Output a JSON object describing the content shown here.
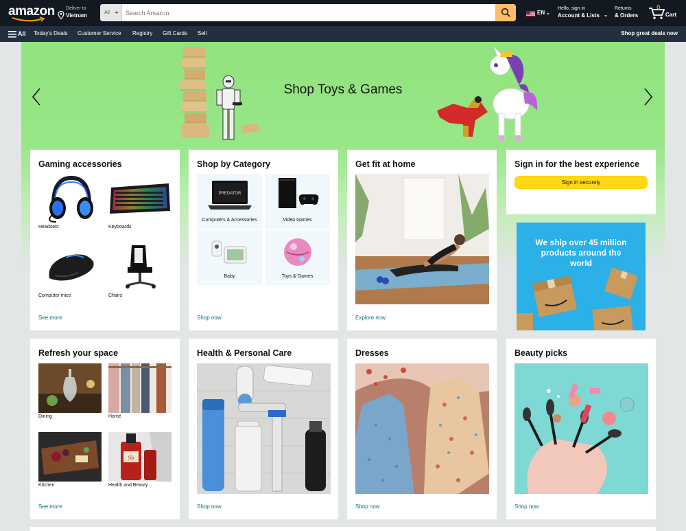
{
  "header": {
    "logo_text": "amazon",
    "deliver_label": "Deliver to",
    "deliver_location": "Vietnam",
    "search_category": "All",
    "search_placeholder": "Search Amazon",
    "language": "EN",
    "account_greeting": "Hello, sign in",
    "account_label": "Account & Lists",
    "returns_label": "Returns",
    "orders_label": "& Orders",
    "cart_count": "0",
    "cart_label": "Cart"
  },
  "subnav": {
    "all_label": "All",
    "links": [
      "Today's Deals",
      "Customer Service",
      "Registry",
      "Gift Cards",
      "Sell"
    ],
    "promo": "Shop great deals now"
  },
  "hero": {
    "title": "Shop Toys & Games"
  },
  "cards": {
    "gaming": {
      "title": "Gaming accessories",
      "items": [
        "Headsets",
        "Keyboards",
        "Computer mice",
        "Chairs"
      ],
      "link": "See more"
    },
    "category": {
      "title": "Shop by Category",
      "items": [
        "Computers & Accessories",
        "Video Games",
        "Baby",
        "Toys & Games"
      ],
      "link": "Shop now"
    },
    "fit": {
      "title": "Get fit at home",
      "link": "Explore now"
    },
    "signin": {
      "title": "Sign in for the best experience",
      "button": "Sign in securely"
    },
    "ad": {
      "text": "We ship over 45 million products around the world"
    },
    "refresh": {
      "title": "Refresh your space",
      "items": [
        "Dining",
        "Home",
        "Kitchen",
        "Health and Beauty"
      ],
      "link": "See more"
    },
    "health": {
      "title": "Health & Personal Care",
      "link": "Shop now"
    },
    "dresses": {
      "title": "Dresses",
      "link": "Shop now"
    },
    "beauty": {
      "title": "Beauty picks",
      "link": "Shop now"
    }
  },
  "colors": {
    "nav_dark": "#131921",
    "nav_sub": "#232f3e",
    "search_button": "#febd69",
    "link": "#007185",
    "signin_button": "#ffd814",
    "hero_green": "#91e37e",
    "ad_blue": "#2bb0e8"
  }
}
